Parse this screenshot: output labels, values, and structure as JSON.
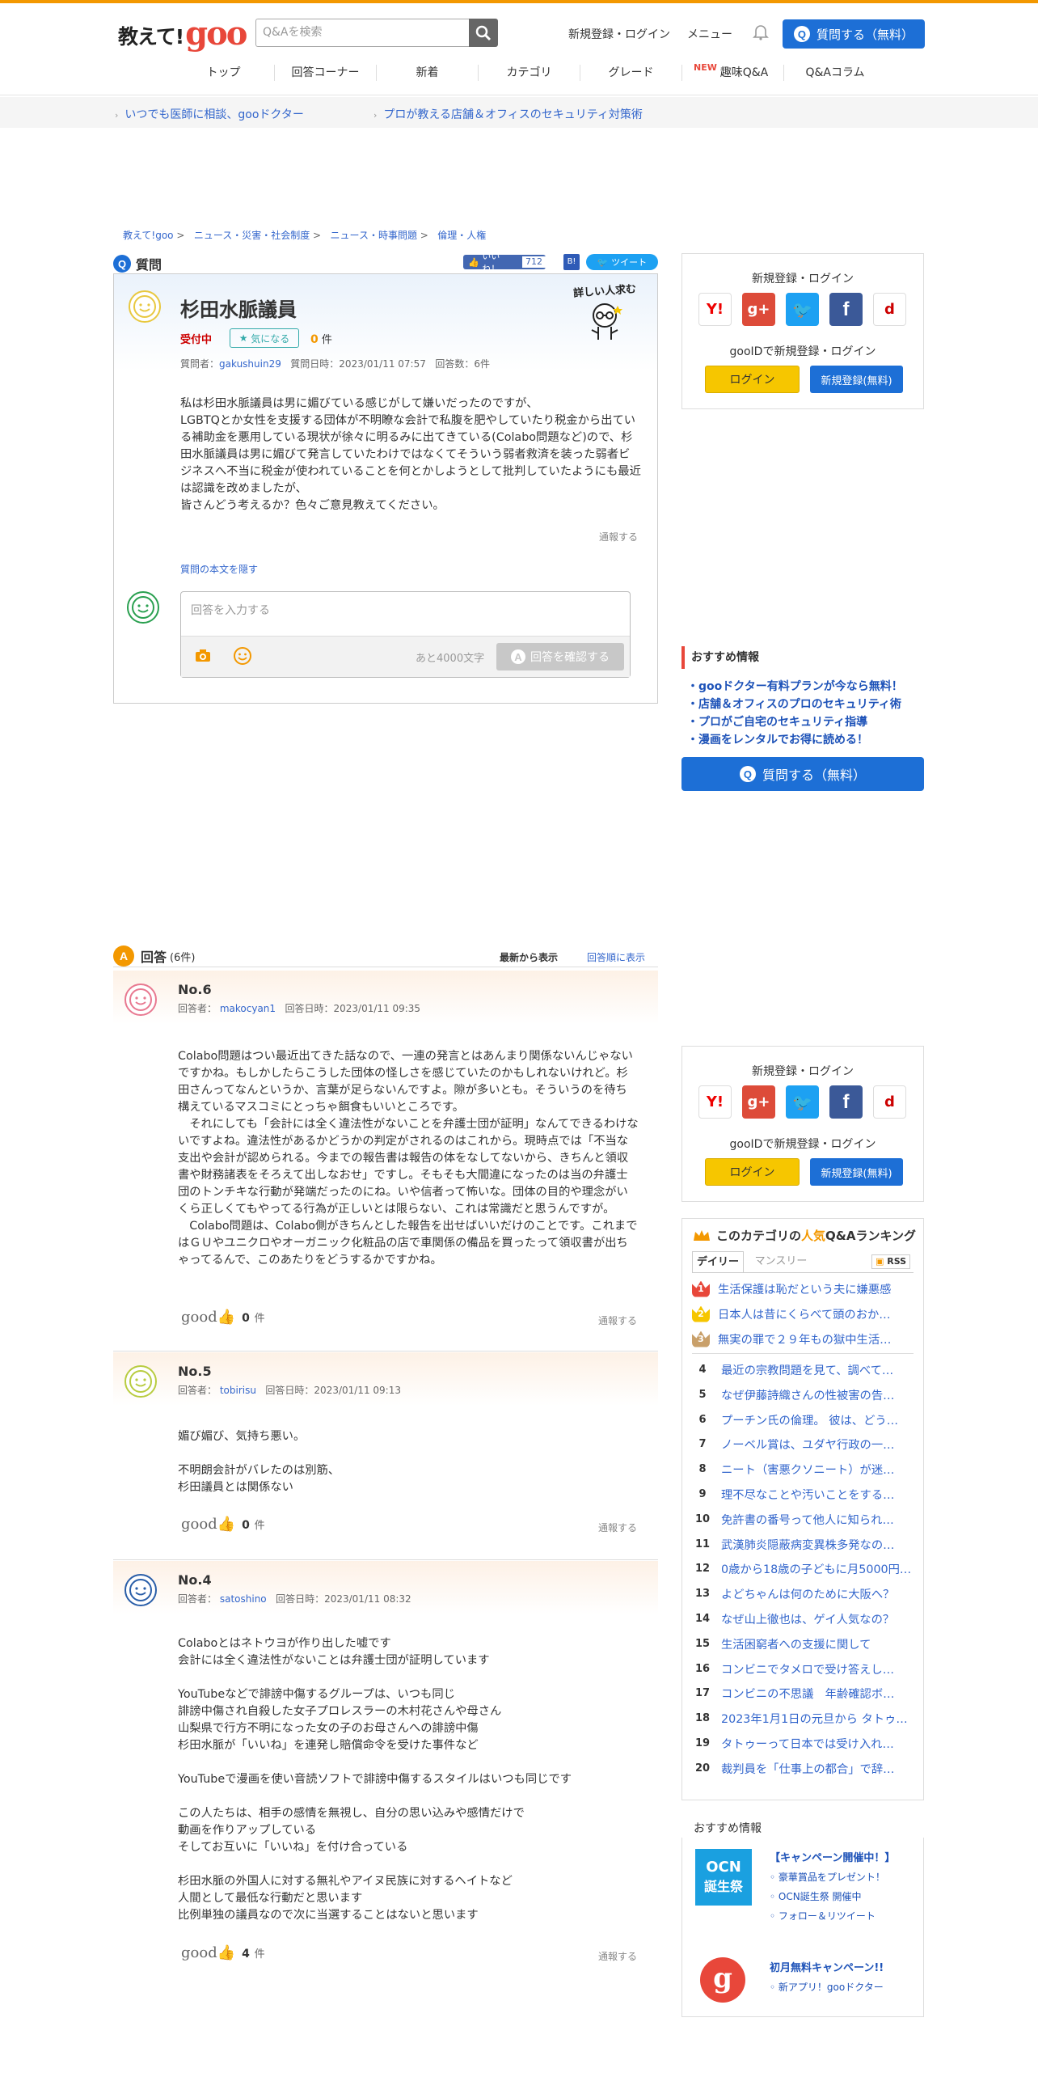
{
  "header": {
    "logo_text": "教えて!",
    "logo_goo": "goo",
    "search_placeholder": "Q&Aを検索",
    "login": "新規登録・ログイン",
    "menu": "メニュー",
    "ask_button": "質問する（無料）"
  },
  "nav": {
    "items": [
      "トップ",
      "回答コーナー",
      "新着",
      "カテゴリ",
      "グレード",
      "趣味Q&A",
      "Q&Aコラム"
    ],
    "new_badge": "NEW"
  },
  "subbar": {
    "link1": "いつでも医師に相談、gooドクター",
    "link2": "プロが教える店舗＆オフィスのセキュリティ対策術"
  },
  "breadcrumb": [
    "教えて!goo",
    "ニュース・災害・社会制度",
    "ニュース・時事問題",
    "倫理・人権"
  ],
  "question": {
    "section_label": "質問",
    "like_label": "いいね！",
    "like_count": "712",
    "tweet": "ツイート",
    "title": "杉田水脈議員",
    "status": "受付中",
    "fav": "気になる",
    "answer_count": "0",
    "answer_unit": "件",
    "detail_badge": "詳しい人求む",
    "meta": {
      "asker_label": "質問者：",
      "asker": "gakushuin29",
      "date": "質問日時：2023/01/11 07:57",
      "answers": "回答数：6件"
    },
    "body": "私は杉田水脈議員は男に媚びている感じがして嫌いだったのですが、\nLGBTQとか女性を支援する団体が不明瞭な会計で私腹を肥やしていたり税金から出ている補助金を悪用している現状が徐々に明るみに出てきている(Colabo問題など)ので、杉田水脈議員は男に媚びて発言していたわけではなくてそういう弱者救済を装った弱者ビジネスへ不当に税金が使われていることを何とかしようとして批判していたようにも最近は認識を改めましたが、\n皆さんどう考えるか？色々ご意見教えてください。",
    "report": "通報する",
    "hide_body": "質問の本文を隠す",
    "answer_placeholder": "回答を入力する",
    "char_left": "あと4000文字",
    "confirm": "回答を確認する"
  },
  "side_login": {
    "title": "新規登録・ログイン",
    "gooid": "gooIDで新規登録・ログイン",
    "login": "ログイン",
    "register": "新規登録(無料)",
    "icons": [
      "Y!",
      "g+",
      "twitter",
      "f",
      "d"
    ]
  },
  "recommend": {
    "title": "おすすめ情報",
    "items": [
      "・gooドクター有料プランが今なら無料！",
      "・店舗＆オフィスのプロのセキュリティ術",
      "・プロがご自宅のセキュリティ指導",
      "・漫画をレンタルでお得に読める！"
    ],
    "ask": "質問する（無料）"
  },
  "answers_section": {
    "label": "回答",
    "count": "(6件)",
    "sort_new": "最新から表示",
    "sort_old": "回答順に表示"
  },
  "answers": [
    {
      "no": "No.6",
      "answerer_label": "回答者：",
      "answerer": "makocyan1",
      "date": "回答日時：2023/01/11 09:35",
      "body": "Colabo問題はつい最近出てきた話なので、一連の発言とはあんまり関係ないんじゃないですかね。もしかしたらこうした団体の怪しさを感じていたのかもしれないけれど。杉田さんってなんというか、言葉が足らないんですよ。隙が多いとも。そういうのを待ち構えているマスコミにとっちゃ餌食もいいところです。\n　それにしても「会計には全く違法性がないことを弁護士団が証明」なんてできるわけないですよね。違法性があるかどうかの判定がされるのはこれから。現時点では「不当な支出や会計が認められる。今までの報告書は報告の体をなしてないから、きちんと領収書や財務諸表をそろえて出しなおせ」ですし。そもそも大間違になったのは当の弁護士団のトンチキな行動が発端だったのにね。いや信者って怖いな。団体の目的や理念がいくら正しくてもやってる行為が正しいとは限らない、これは常識だと思うんですが。\n　Colabo問題は、Colabo側がきちんとした報告を出せばいいだけのことです。これまではＧＵやユニクロやオーガニック化粧品の店で車関係の備品を買ったって領収書が出ちゃってるんで、このあたりをどうするかですかね。",
      "good": "good",
      "good_count": "0",
      "good_unit": "件",
      "report": "通報する"
    },
    {
      "no": "No.5",
      "answerer_label": "回答者：",
      "answerer": "tobirisu",
      "date": "回答日時：2023/01/11 09:13",
      "body": "媚び媚び、気持ち悪い。\n\n不明朗会計がバレたのは別筋、\n杉田議員とは関係ない",
      "good": "good",
      "good_count": "0",
      "good_unit": "件",
      "report": "通報する"
    },
    {
      "no": "No.4",
      "answerer_label": "回答者：",
      "answerer": "satoshino",
      "date": "回答日時：2023/01/11 08:32",
      "body": "Colaboとはネトウヨが作り出した嘘です\n会計には全く違法性がないことは弁護士団が証明しています\n\nYouTubeなどで誹謗中傷するグループは、いつも同じ\n誹謗中傷され自殺した女子プロレスラーの木村花さんや母さん\n山梨県で行方不明になった女の子のお母さんへの誹謗中傷\n杉田水脈が「いいね」を連発し賠償命令を受けた事件など\n\nYouTubeで漫画を使い音読ソフトで誹謗中傷するスタイルはいつも同じです\n\nこの人たちは、相手の感情を無視し、自分の思い込みや感情だけで\n動画を作りアップしている\nそしてお互いに「いいね」を付け合っている\n\n杉田水脈の外国人に対する無礼やアイヌ民族に対するヘイトなど\n人間として最低な行動だと思います\n比例単独の議員なので次に当選することはないと思います",
      "good": "good",
      "good_count": "4",
      "good_unit": "件",
      "report": "通報する"
    }
  ],
  "ranking": {
    "title_pre": "このカテゴリの",
    "title_hl": "人気",
    "title_post": "Q&Aランキング",
    "tab_daily": "デイリー",
    "tab_monthly": "マンスリー",
    "rss": "RSS",
    "items": [
      {
        "n": "1",
        "t": "生活保護は恥だという夫に嫌悪感"
      },
      {
        "n": "2",
        "t": "日本人は昔にくらべて頭のおか…"
      },
      {
        "n": "3",
        "t": "無実の罪で２９年もの獄中生活…"
      },
      {
        "n": "4",
        "t": "最近の宗教問題を見て、調べて…"
      },
      {
        "n": "5",
        "t": "なぜ伊藤詩織さんの性被害の告…"
      },
      {
        "n": "6",
        "t": "プーチン氏の倫理。 彼は、どう…"
      },
      {
        "n": "7",
        "t": "ノーベル賞は、ユダヤ行政の一…"
      },
      {
        "n": "8",
        "t": "ニート（害悪クソニート）が迷…"
      },
      {
        "n": "9",
        "t": "理不尽なことや汚いことをする…"
      },
      {
        "n": "10",
        "t": "免許書の番号って他人に知られ…"
      },
      {
        "n": "11",
        "t": "武漢肺炎隠蔽病変異株多発なの…"
      },
      {
        "n": "12",
        "t": "0歳から18歳の子どもに月5000円…"
      },
      {
        "n": "13",
        "t": "よどちゃんは何のために大阪へ？"
      },
      {
        "n": "14",
        "t": "なぜ山上徹也は、ゲイ人気なの？"
      },
      {
        "n": "15",
        "t": "生活困窮者への支援に関して"
      },
      {
        "n": "16",
        "t": "コンビニでタメロで受け答えし…"
      },
      {
        "n": "17",
        "t": "コンビニの不思議　年齢確認ボ…"
      },
      {
        "n": "18",
        "t": "2023年1月1日の元旦から タトゥ…"
      },
      {
        "n": "19",
        "t": "タトゥーって日本では受け入れ…"
      },
      {
        "n": "20",
        "t": "裁判員を「仕事上の都合」で辞…"
      }
    ]
  },
  "recommend2": {
    "title": "おすすめ情報",
    "ocn_top": "OCN",
    "ocn_bottom": "誕生祭",
    "promo1_title": "【キャンペーン開催中！】",
    "promo1_items": [
      "豪華賞品をプレゼント！",
      "OCN誕生祭 開催中",
      "フォロー＆リツイート"
    ],
    "promo2_title": "初月無料キャンペーン!!",
    "promo2_items": [
      "新アプリ！gooドクター"
    ],
    "goo_letter": "g"
  },
  "colors": {
    "accent": "#1d6fd6",
    "orange": "#f39800",
    "red": "#e8473a"
  }
}
